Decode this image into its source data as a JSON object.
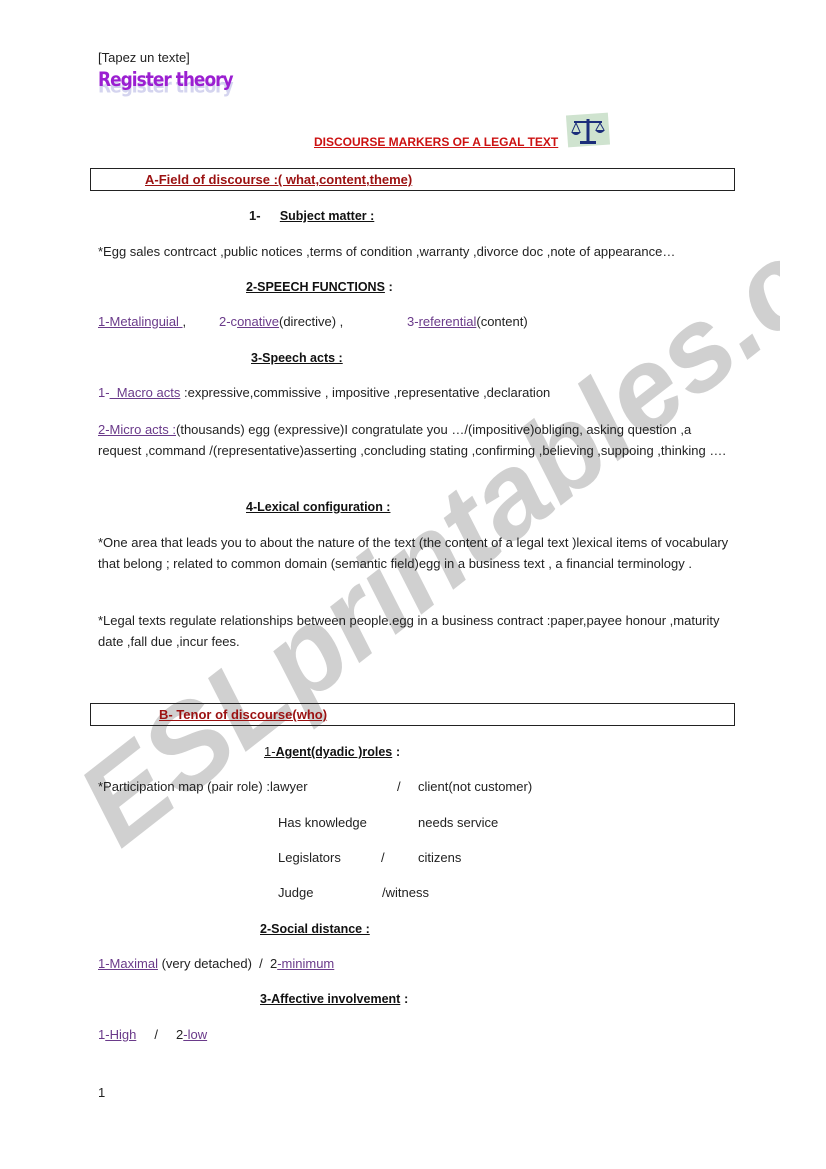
{
  "header": {
    "placeholder_text": "[Tapez un texte]",
    "logo_text": "Register theory"
  },
  "title": {
    "text": "DISCOURSE MARKERS OF A LEGAL TEXT",
    "icon": "scales-of-justice-icon"
  },
  "section_a": {
    "label": "A-Field of discourse :( what,content,theme)",
    "subject_matter": {
      "number": "1-",
      "heading": "Subject matter :",
      "text": "*Egg sales contrcact ,public notices ,terms of condition ,warranty ,divorce doc ,note of appearance…"
    },
    "speech_functions": {
      "heading": "2-SPEECH FUNCTIONS",
      "colon": " :",
      "items": [
        {
          "prefix": "",
          "link": "1-Metalinguial ",
          "suffix": ","
        },
        {
          "prefix": "2-c",
          "link": "onative",
          "suffix": "(directive) ,"
        },
        {
          "prefix": "3-",
          "link": "referential",
          "suffix": "(content)"
        }
      ]
    },
    "speech_acts": {
      "heading": "3-Speech acts :",
      "macro": {
        "prefix": "1-",
        "link": "  Macro acts",
        "text": " :expressive,commissive , impositive ,representative ,declaration"
      },
      "micro": {
        "link": "2-Micro acts :",
        "text": "(thousands) egg (expressive)I congratulate you …/(impositive)obliging, asking question ,a request ,command /(representative)asserting ,concluding stating ,confirming ,believing ,suppoing ,thinking …."
      }
    },
    "lexical_configuration": {
      "heading": "4-Lexical configuration :",
      "paragraphs": [
        "*One area that leads you to about the nature of the text (the content of a legal text )lexical items of vocabulary that belong ; related to common domain (semantic field)egg in a business text , a financial terminology  .",
        "*Legal texts regulate relationships between people.egg in a business contract :paper,payee honour ,maturity date ,fall due ,incur fees."
      ]
    }
  },
  "section_b": {
    "label": "B- Tenor  of discourse(who)",
    "agent_roles": {
      "heading_prefix": "1-",
      "heading": "Agent(dyadic )roles",
      "colon": " :",
      "intro": "*Participation map (pair role) :lawyer",
      "rows": [
        {
          "left": "",
          "sep": "/",
          "right": "client(not customer)"
        },
        {
          "left": "Has knowledge",
          "sep": "",
          "right": "needs service"
        },
        {
          "left": "Legislators",
          "sep": "/",
          "right": "citizens"
        },
        {
          "left": "Judge",
          "sep": "/witness",
          "right": ""
        }
      ]
    },
    "social_distance": {
      "heading": "2-Social distance :",
      "items": {
        "first_link": "1-Maximal",
        "middle": " (very detached)  /  2",
        "second_link": "-minimum"
      }
    },
    "affective_involvement": {
      "heading": "3-Affective involvement",
      "colon": " :",
      "items": {
        "p1": "1",
        "l1": "-High",
        "sep": "     /     2",
        "l2": "-low"
      }
    }
  },
  "footer": {
    "page_number": "1"
  },
  "watermark": {
    "text": "ESLprintables.com"
  }
}
